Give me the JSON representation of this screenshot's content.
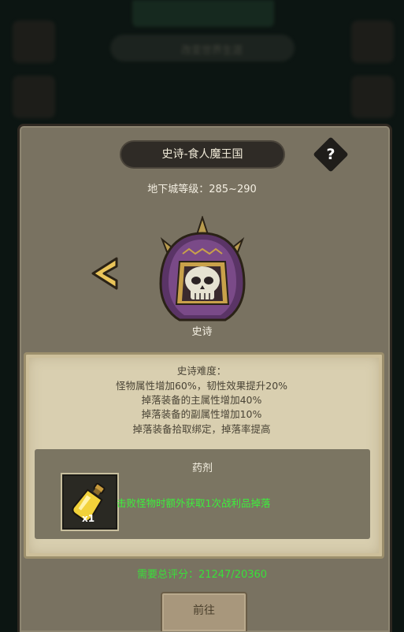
{
  "background": {
    "pill_text": "改变世界生涯"
  },
  "dialog": {
    "title": "史诗-食人魔王国",
    "help_label": "?",
    "dungeon_level": "地下城等级：285~290",
    "boss_icon": "skull-helmet-icon",
    "difficulty_label": "史诗",
    "description": [
      "史诗难度：",
      "怪物属性增加60%，韧性效果提升20%",
      "掉落装备的主属性增加40%",
      "掉落装备的副属性增加10%",
      "掉落装备拾取绑定，掉落率提高"
    ],
    "potion": {
      "title": "药剂",
      "item_icon": "potion-bottle-icon",
      "count": "x1",
      "effect": "击败怪物时额外获取1次战利品掉落"
    },
    "score": "需要总评分：21247/20360",
    "go_button": "前往"
  },
  "colors": {
    "panel": "#797261",
    "parchment": "#d9cfb0",
    "highlight_green": "#3cf03c",
    "boss_purple": "#6b3e78"
  }
}
